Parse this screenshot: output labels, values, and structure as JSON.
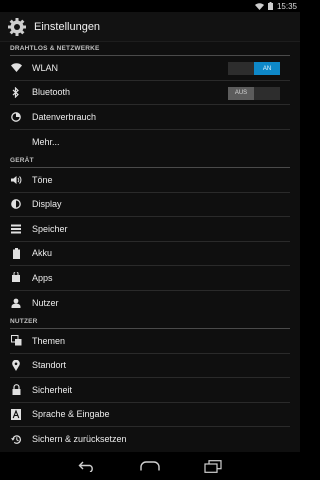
{
  "status_bar": {
    "time": "15:35",
    "wifi_icon": "wifi-icon",
    "battery_icon": "battery-icon"
  },
  "header": {
    "title": "Einstellungen",
    "icon": "gear-icon"
  },
  "sections": [
    {
      "title": "DRAHTLOS & NETZWERKE",
      "items": [
        {
          "label": "WLAN",
          "icon": "wifi-icon",
          "toggle": "AN"
        },
        {
          "label": "Bluetooth",
          "icon": "bluetooth-icon",
          "toggle": "AUS"
        },
        {
          "label": "Datenverbrauch",
          "icon": "data-usage-icon"
        },
        {
          "label": "Mehr..."
        }
      ]
    },
    {
      "title": "GERÄT",
      "items": [
        {
          "label": "Töne",
          "icon": "volume-icon"
        },
        {
          "label": "Display",
          "icon": "brightness-icon"
        },
        {
          "label": "Speicher",
          "icon": "storage-icon"
        },
        {
          "label": "Akku",
          "icon": "battery-icon"
        },
        {
          "label": "Apps",
          "icon": "apps-icon"
        },
        {
          "label": "Nutzer",
          "icon": "user-icon"
        }
      ]
    },
    {
      "title": "NUTZER",
      "items": [
        {
          "label": "Themen",
          "icon": "themes-icon"
        },
        {
          "label": "Standort",
          "icon": "location-icon"
        },
        {
          "label": "Sicherheit",
          "icon": "lock-icon"
        },
        {
          "label": "Sprache & Eingabe",
          "icon": "keyboard-icon"
        },
        {
          "label": "Sichern & zurücksetzen",
          "icon": "backup-icon"
        }
      ]
    }
  ],
  "nav_bar": {
    "back_icon": "back-icon",
    "home_icon": "home-icon",
    "recents_icon": "recents-icon"
  },
  "colors": {
    "accent": "#0e88c8",
    "background": "#0f0f0f",
    "divider": "#2a2a2a"
  }
}
